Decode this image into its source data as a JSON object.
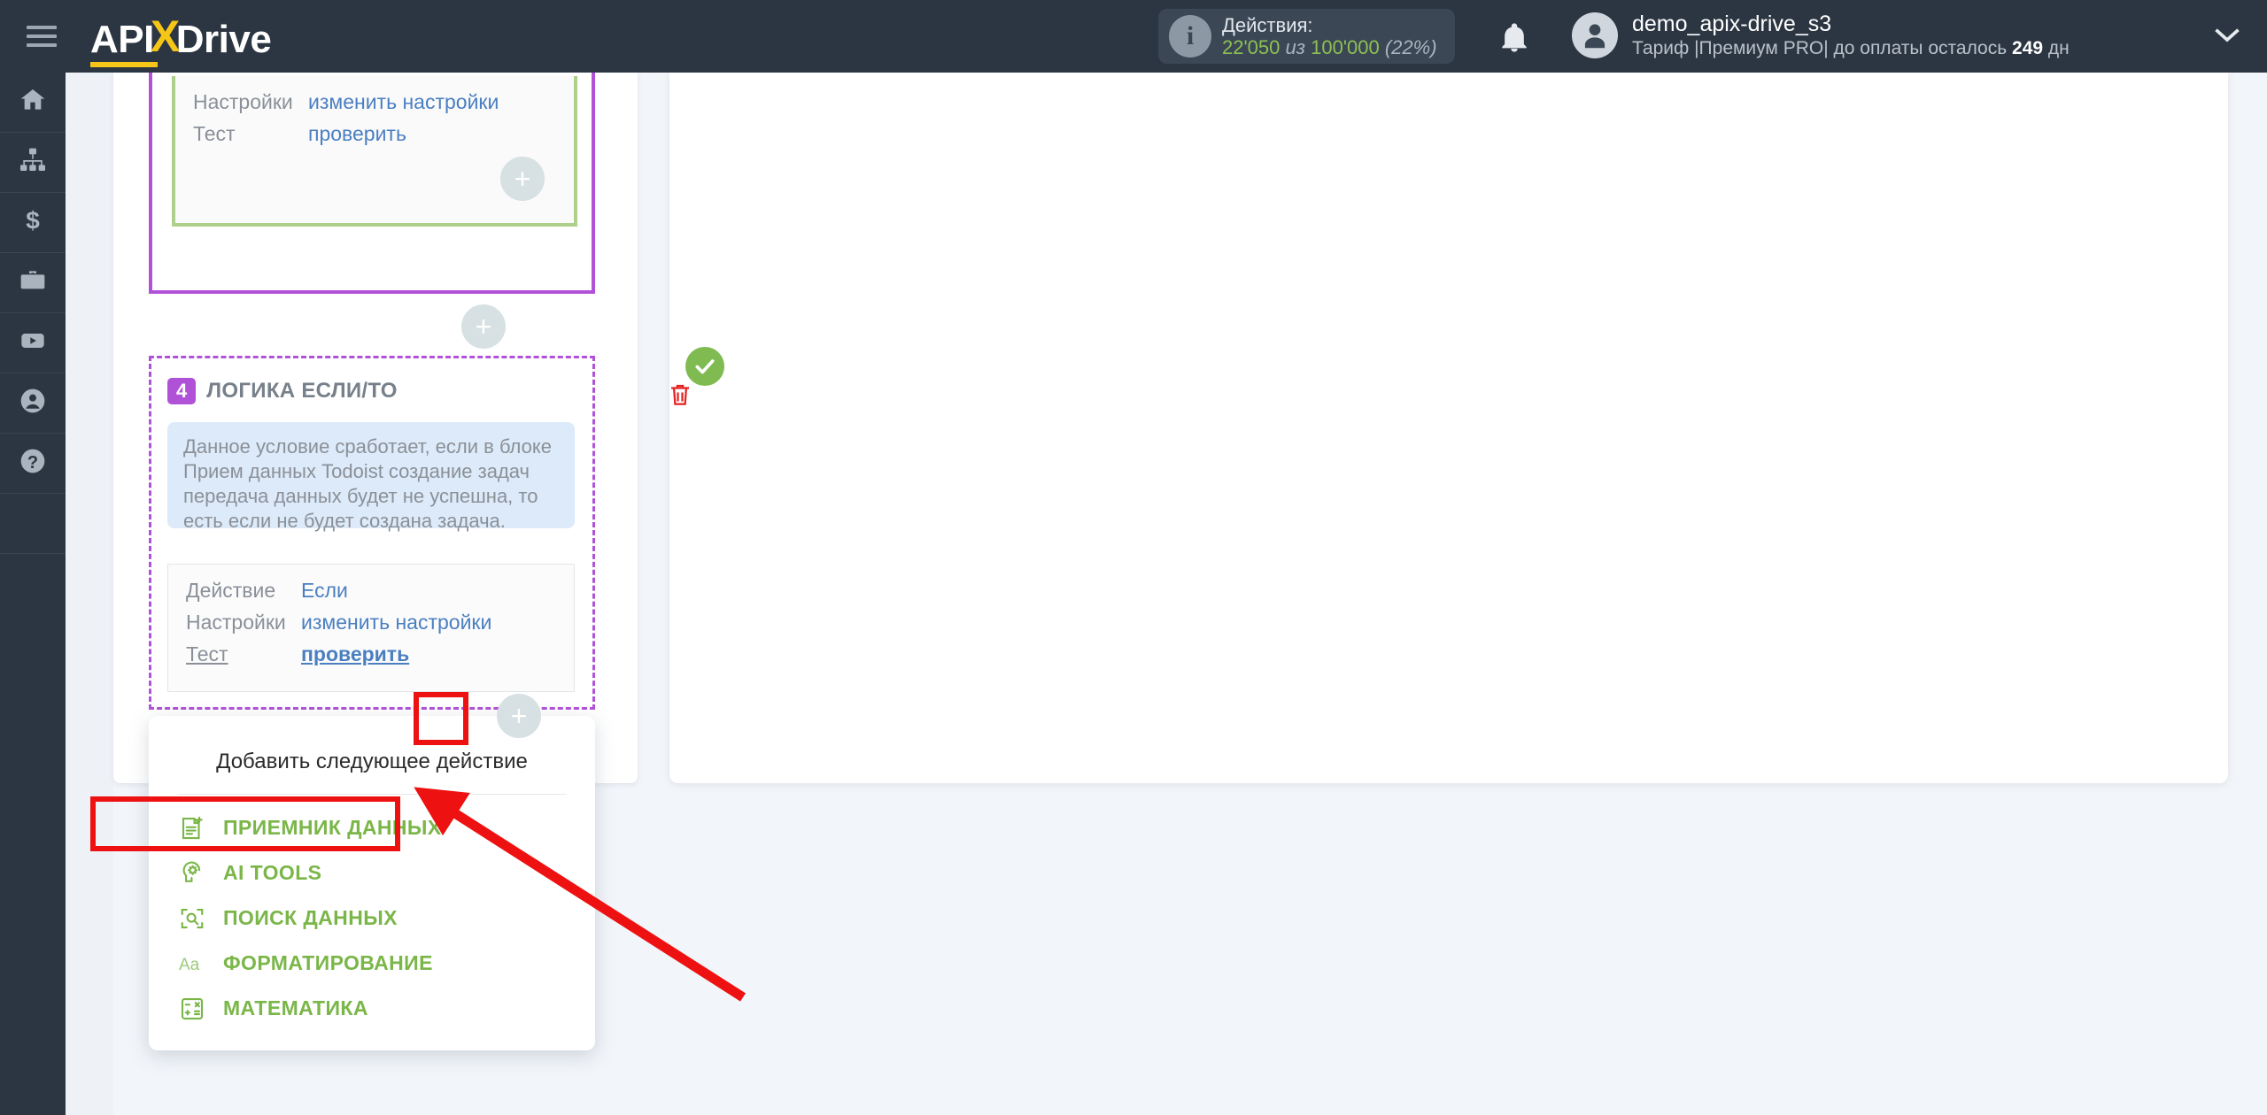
{
  "header": {
    "logo": {
      "part1": "API",
      "part2": "X",
      "part3": "Drive"
    },
    "menu_icon": "hamburger-icon",
    "actions": {
      "label": "Действия:",
      "used": "22'050",
      "separator": "из",
      "total": "100'000",
      "percent": "(22%)"
    },
    "user": {
      "name": "demo_apix-drive_s3",
      "plan_prefix": "Тариф |Премиум PRO| до оплаты осталось ",
      "plan_days": "249",
      "plan_suffix": " дн"
    }
  },
  "sidebar": {
    "items": [
      {
        "name": "home-icon",
        "label": "Главная"
      },
      {
        "name": "connections-icon",
        "label": "Связи"
      },
      {
        "name": "dollar-icon",
        "label": "Оплата"
      },
      {
        "name": "briefcase-icon",
        "label": "Бизнес"
      },
      {
        "name": "youtube-icon",
        "label": "Видео"
      },
      {
        "name": "user-icon",
        "label": "Профиль"
      },
      {
        "name": "help-icon",
        "label": "Помощь"
      }
    ]
  },
  "top_block": {
    "rows": [
      {
        "key": "Настройки",
        "value": "изменить настройки"
      },
      {
        "key": "Тест",
        "value": "проверить"
      }
    ]
  },
  "block4": {
    "number": "4",
    "title": "ЛОГИКА ЕСЛИ/ТО",
    "info": "Данное условие сработает, если в блоке Прием данных Todoist создание задач передача данных будет не успешна, то есть если не будет создана задача.",
    "rows": [
      {
        "key": "Действие",
        "value": "Если"
      },
      {
        "key": "Настройки",
        "value": "изменить настройки"
      },
      {
        "key": "Тест",
        "value": "проверить"
      }
    ],
    "status_icon": "check-circle-icon",
    "delete_icon": "trash-icon"
  },
  "dropdown": {
    "title": "Добавить следующее действие",
    "items": [
      {
        "icon": "data-receiver-icon",
        "label": "ПРИЕМНИК ДАННЫХ"
      },
      {
        "icon": "ai-tools-icon",
        "label": "AI TOOLS"
      },
      {
        "icon": "data-search-icon",
        "label": "ПОИСК ДАННЫХ"
      },
      {
        "icon": "formatting-icon",
        "label": "ФОРМАТИРОВАНИЕ"
      },
      {
        "icon": "math-icon",
        "label": "МАТЕМАТИКА"
      }
    ]
  },
  "annotations": {
    "highlight_color": "#ee1111",
    "arrow": "points-to-data-receiver-item"
  },
  "colors": {
    "header_bg": "#2c3642",
    "accent_yellow": "#f5c518",
    "purple": "#b052d8",
    "green": "#7ab648",
    "link_blue": "#4a7fc1",
    "page_bg": "#f2f5f9"
  }
}
